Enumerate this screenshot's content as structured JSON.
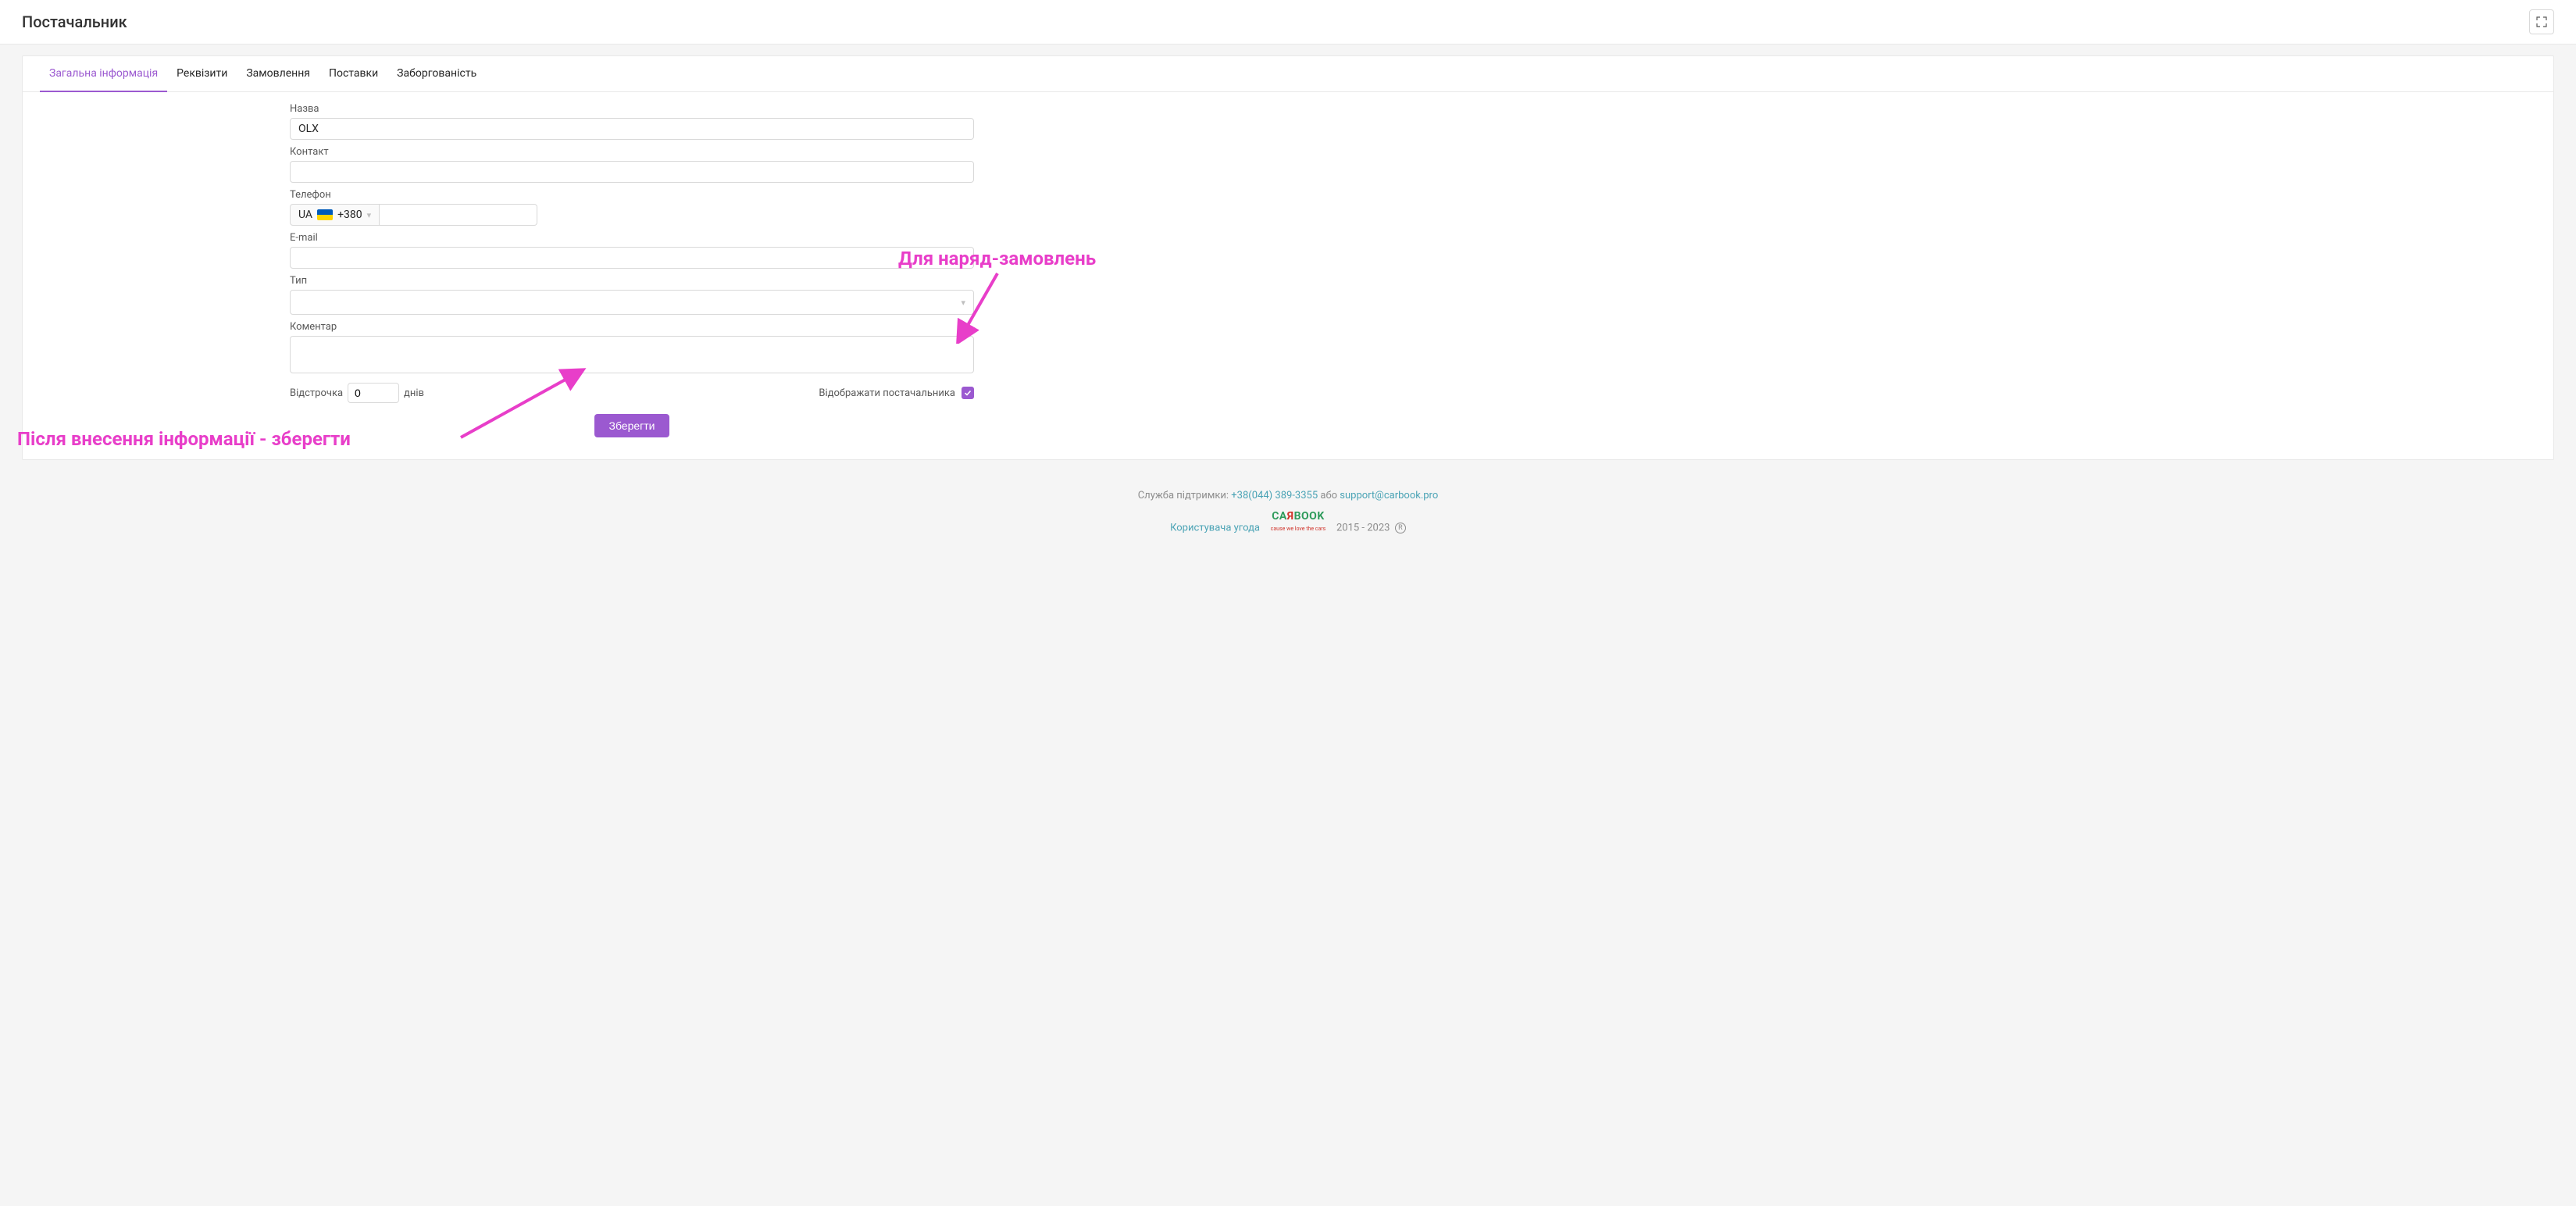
{
  "header": {
    "title": "Постачальник"
  },
  "tabs": [
    {
      "label": "Загальна інформація",
      "active": true
    },
    {
      "label": "Реквізити",
      "active": false
    },
    {
      "label": "Замовлення",
      "active": false
    },
    {
      "label": "Поставки",
      "active": false
    },
    {
      "label": "Заборгованість",
      "active": false
    }
  ],
  "form": {
    "name_label": "Назва",
    "name_value": "OLX",
    "contact_label": "Контакт",
    "contact_value": "",
    "phone_label": "Телефон",
    "phone_country": "UA",
    "phone_prefix": "+380",
    "phone_number": "",
    "email_label": "E-mail",
    "email_value": "",
    "type_label": "Тип",
    "type_value": "",
    "comment_label": "Коментар",
    "comment_value": "",
    "deferral_label": "Відстрочка",
    "deferral_value": "0",
    "deferral_unit": "днів",
    "show_supplier_label": "Відображати постачальника",
    "show_supplier_checked": true,
    "save_label": "Зберегти"
  },
  "annotations": {
    "right": "Для наряд-замовлень",
    "bottom": "Після внесення інформації - зберегти"
  },
  "footer": {
    "support_prefix": "Служба підтримки:",
    "phone": "+38(044) 389-3355",
    "or": "або",
    "email": "support@carbook.pro",
    "agreement": "Користувача угода",
    "years": "2015 - 2023",
    "logo_sub": "cause we love the cars"
  }
}
